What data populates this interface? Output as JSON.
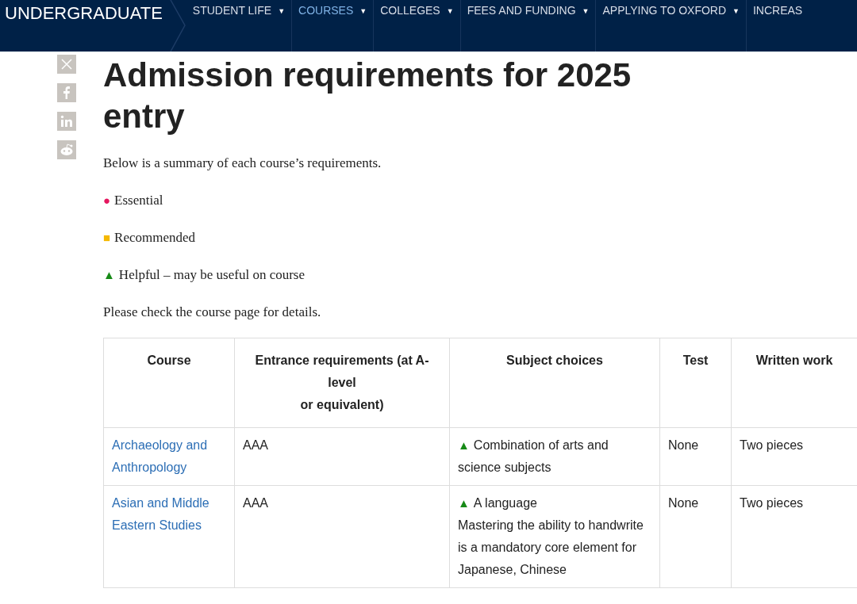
{
  "header": {
    "brand": "UNDERGRADUATE",
    "nav": [
      {
        "label": "STUDENT LIFE",
        "selected": false,
        "caret": "▼"
      },
      {
        "label": "COURSES",
        "selected": true,
        "caret": "▼"
      },
      {
        "label": "COLLEGES",
        "selected": false,
        "caret": "▼"
      },
      {
        "label": "FEES AND FUNDING",
        "selected": false,
        "caret": "▼"
      },
      {
        "label": "APPLYING TO OXFORD",
        "selected": false,
        "caret": "▼"
      },
      {
        "label": "INCREAS",
        "selected": false
      }
    ]
  },
  "share": [
    {
      "kind": "x"
    },
    {
      "kind": "facebook"
    },
    {
      "kind": "linkedin"
    },
    {
      "kind": "reddit"
    }
  ],
  "title": "Admission requirements for 2025 entry",
  "intro": "Below is a summary of each course’s requirements.",
  "legend": [
    {
      "kind": "essential",
      "marker": "●",
      "label": "Essential"
    },
    {
      "kind": "recommended",
      "marker": "■",
      "label": "Recommended"
    },
    {
      "kind": "helpful",
      "marker": "▲",
      "label": "Helpful – may be useful on course"
    }
  ],
  "note": "Please check the course page for details.",
  "table": {
    "columns": [
      "Course",
      "Entrance requirements (at A-level\nor equivalent)",
      "Subject choices",
      "Test",
      "Written work"
    ],
    "rows": [
      {
        "course": "Archaeology and Anthropology",
        "entrance": "AAA",
        "subjects": [
          {
            "kind": "helpful",
            "marker": "▲",
            "text": "Combination of arts and science subjects"
          }
        ],
        "test": "None",
        "written": "Two pieces"
      },
      {
        "course": "Asian and Middle Eastern Studies",
        "entrance": "AAA",
        "subjects": [
          {
            "kind": "helpful",
            "marker": "▲",
            "text": "A language"
          },
          {
            "kind": "plain",
            "text": "Mastering the ability to handwrite is a mandatory core element for Japanese, Chinese"
          }
        ],
        "test": "None",
        "written": "Two pieces"
      }
    ]
  }
}
